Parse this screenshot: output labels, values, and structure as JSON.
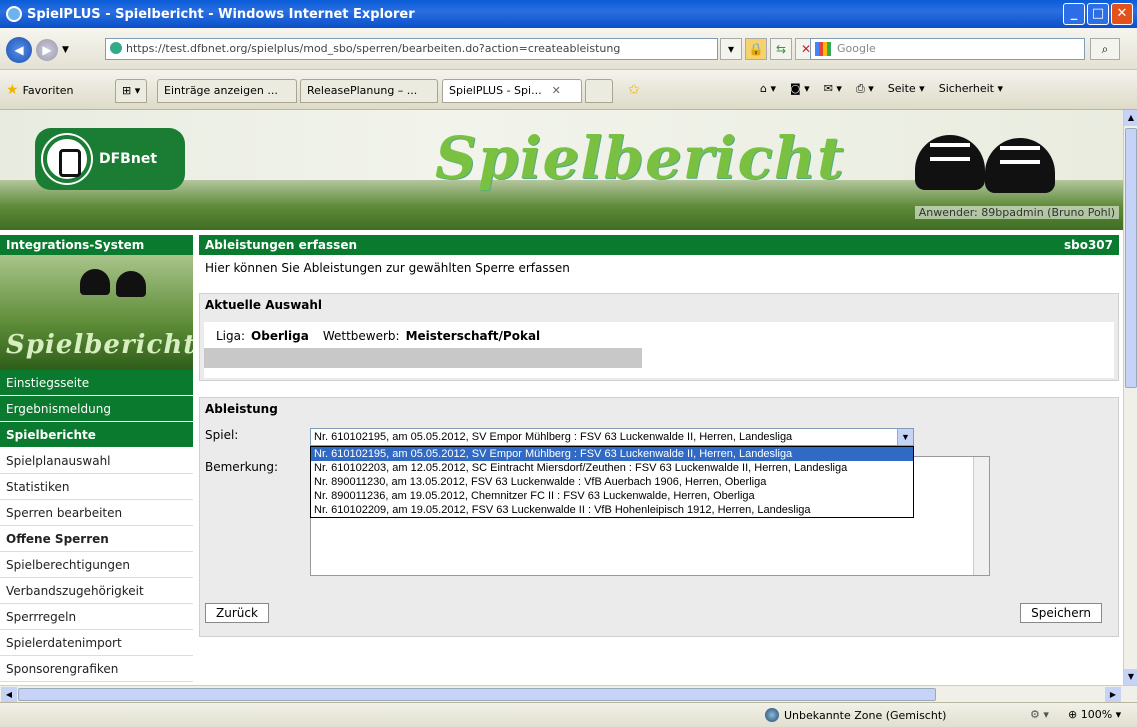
{
  "window": {
    "title": "SpielPLUS - Spielbericht - Windows Internet Explorer"
  },
  "address": {
    "url": "https://test.dfbnet.org/spielplus/mod_sbo/sperren/bearbeiten.do?action=createableistung",
    "search_placeholder": "Google"
  },
  "favorites": {
    "label": "Favoriten"
  },
  "tabs": [
    {
      "label": "Einträge anzeigen ..."
    },
    {
      "label": "ReleasePlanung – ..."
    },
    {
      "label": "SpielPLUS - Spi..."
    }
  ],
  "toolbar": {
    "seite": "Seite",
    "sicherheit": "Sicherheit"
  },
  "banner": {
    "logo_text": "DFBnet",
    "title": "Spielbericht",
    "user": "Anwender: 89bpadmin (Bruno Pohl)"
  },
  "sidebar": {
    "header": "Integrations-System",
    "image_text": "Spielbericht",
    "items": [
      {
        "label": "Einstiegsseite"
      },
      {
        "label": "Ergebnismeldung"
      },
      {
        "label": "Spielberichte"
      },
      {
        "label": "Spielplanauswahl"
      },
      {
        "label": "Statistiken"
      },
      {
        "label": "Sperren bearbeiten"
      },
      {
        "label": "Offene Sperren"
      },
      {
        "label": "Spielberechtigungen"
      },
      {
        "label": "Verbandszugehörigkeit"
      },
      {
        "label": "Sperrregeln"
      },
      {
        "label": "Spielerdatenimport"
      },
      {
        "label": "Sponsorengrafiken"
      }
    ]
  },
  "main": {
    "title": "Ableistungen erfassen",
    "code": "sbo307",
    "intro": "Hier können Sie Ableistungen zur gewählten Sperre erfassen",
    "auswahl": {
      "heading": "Aktuelle Auswahl",
      "liga_label": "Liga:",
      "liga_value": "Oberliga",
      "wettbewerb_label": "Wettbewerb:",
      "wettbewerb_value": "Meisterschaft/Pokal"
    },
    "ableistung": {
      "heading": "Ableistung",
      "spiel_label": "Spiel:",
      "spiel_selected": "Nr. 610102195, am 05.05.2012, SV Empor Mühlberg : FSV 63 Luckenwalde II, Herren, Landesliga",
      "bemerkung_label": "Bemerkung:",
      "options": [
        "Nr. 610102195, am 05.05.2012, SV Empor Mühlberg : FSV 63 Luckenwalde II, Herren, Landesliga",
        "Nr. 610102203, am 12.05.2012, SC Eintracht Miersdorf/Zeuthen : FSV 63 Luckenwalde II, Herren, Landesliga",
        "Nr. 890011230, am 13.05.2012, FSV 63 Luckenwalde : VfB Auerbach 1906, Herren, Oberliga",
        "Nr. 890011236, am 19.05.2012, Chemnitzer FC II : FSV 63 Luckenwalde, Herren, Oberliga",
        "Nr. 610102209, am 19.05.2012, FSV 63 Luckenwalde II : VfB Hohenleipisch 1912, Herren, Landesliga"
      ]
    },
    "back_label": "Zurück",
    "save_label": "Speichern"
  },
  "status": {
    "zone": "Unbekannte Zone (Gemischt)",
    "zoom": "100%"
  }
}
